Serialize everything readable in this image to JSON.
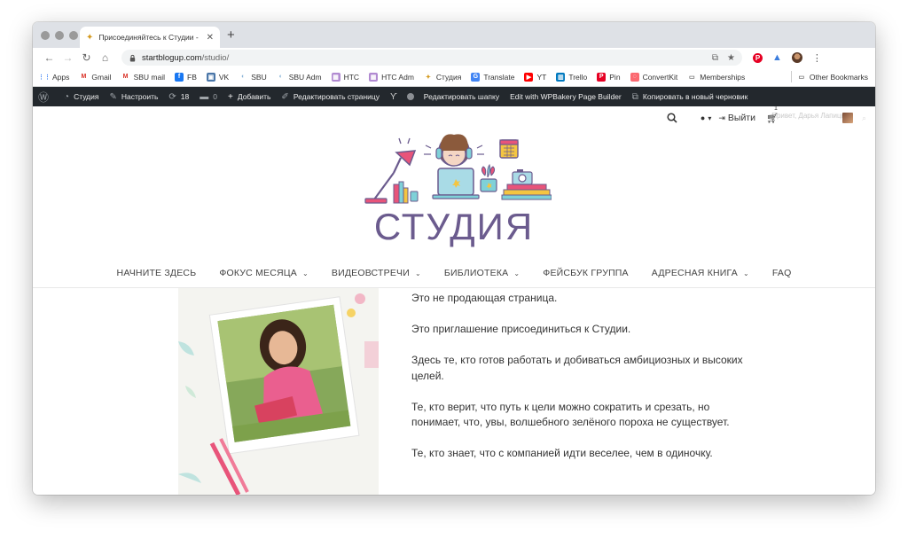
{
  "browser": {
    "tab_title": "Присоединяйтесь к Студии -",
    "url_host": "startblogup.com",
    "url_path": "/studio/"
  },
  "bookmarks": [
    {
      "label": "Apps",
      "icon": "apps-grid-icon",
      "color": "#4285f4"
    },
    {
      "label": "Gmail",
      "icon": "gmail-icon",
      "color": "#d93025"
    },
    {
      "label": "SBU mail",
      "icon": "gmail-icon",
      "color": "#d93025"
    },
    {
      "label": "FB",
      "icon": "facebook-icon",
      "color": "#1877f2"
    },
    {
      "label": "VK",
      "icon": "vk-icon",
      "color": "#4a76a8"
    },
    {
      "label": "SBU",
      "icon": "sbu-icon",
      "color": "#8ab4d8"
    },
    {
      "label": "SBU Adm",
      "icon": "sbu-icon",
      "color": "#8ab4d8"
    },
    {
      "label": "HTC",
      "icon": "htc-icon",
      "color": "#b18ad1"
    },
    {
      "label": "HTC Adm",
      "icon": "htc-icon",
      "color": "#b18ad1"
    },
    {
      "label": "Студия",
      "icon": "studio-icon",
      "color": "#d49a1f"
    },
    {
      "label": "Translate",
      "icon": "translate-icon",
      "color": "#4285f4"
    },
    {
      "label": "YT",
      "icon": "youtube-icon",
      "color": "#ff0000"
    },
    {
      "label": "Trello",
      "icon": "trello-icon",
      "color": "#0079bf"
    },
    {
      "label": "Pin",
      "icon": "pinterest-icon",
      "color": "#e60023"
    },
    {
      "label": "ConvertKit",
      "icon": "convertkit-icon",
      "color": "#fb6970"
    },
    {
      "label": "Memberships",
      "icon": "folder-icon",
      "color": "#666666"
    }
  ],
  "other_bookmarks": "Other Bookmarks",
  "adminbar": {
    "site": "Студия",
    "customize": "Настроить",
    "updates_count": "18",
    "comments_count": "0",
    "add_new": "Добавить",
    "edit_page": "Редактировать страницу",
    "edit_header": "Редактировать шапку",
    "wpbakery": "Edit with WPBakery Page Builder",
    "copy_draft": "Копировать в новый черновик"
  },
  "userbar": {
    "login": "Выйти",
    "cart_count": "1",
    "greeting": "Привет, Дарья Лапицкая"
  },
  "logo_text": "СТУДИЯ",
  "nav": [
    {
      "label": "НАЧНИТЕ ЗДЕСЬ",
      "has_dropdown": false
    },
    {
      "label": "ФОКУС МЕСЯЦА",
      "has_dropdown": true
    },
    {
      "label": "ВИДЕОВСТРЕЧИ",
      "has_dropdown": true
    },
    {
      "label": "БИБЛИОТЕКА",
      "has_dropdown": true
    },
    {
      "label": "ФЕЙСБУК ГРУППА",
      "has_dropdown": false
    },
    {
      "label": "АДРЕСНАЯ КНИГА",
      "has_dropdown": true
    },
    {
      "label": "FAQ",
      "has_dropdown": false
    }
  ],
  "content": {
    "paragraphs": [
      "Это не продающая страница.",
      "Это приглашение присоединиться к Студии.",
      "Здесь те, кто готов работать и добиваться амбициозных и высоких целей.",
      "Те, кто верит, что путь к цели можно сократить и срезать, но понимает, что, увы, волшебного зелёного пороха не существует.",
      "Те, кто знает, что с компанией идти веселее, чем в одиночку."
    ]
  },
  "colors": {
    "adminbar_bg": "#23282d",
    "logo_text": "#6b5b8e",
    "accent_pink": "#e8547a"
  }
}
